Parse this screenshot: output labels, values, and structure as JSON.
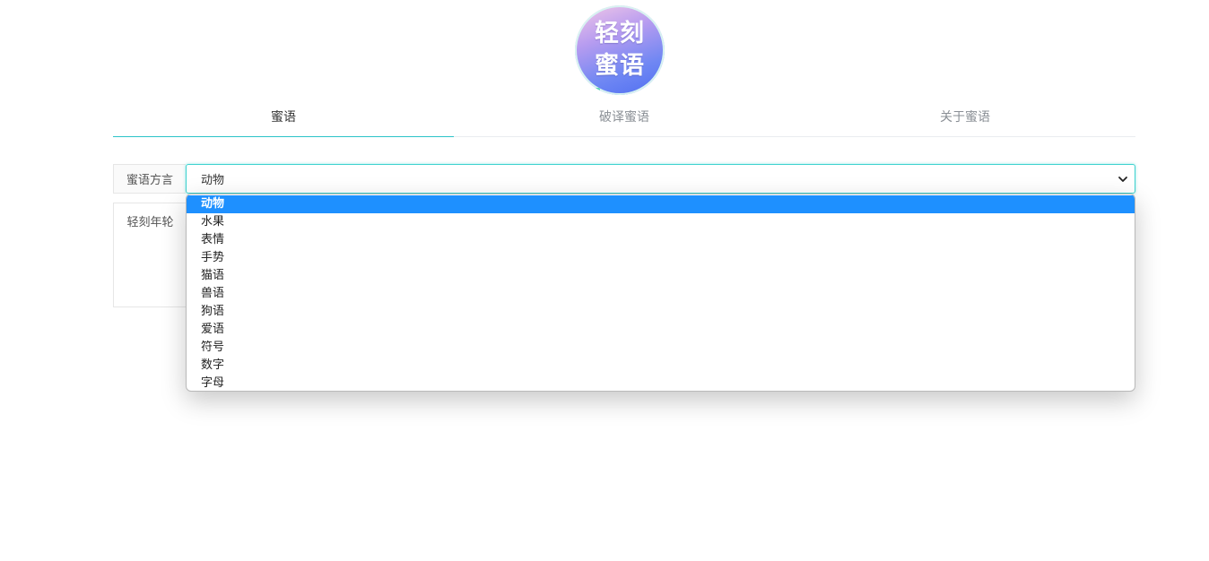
{
  "logo": {
    "line1": "轻刻",
    "line2": "蜜语"
  },
  "tabs": [
    {
      "label": "蜜语",
      "active": true
    },
    {
      "label": "破译蜜语",
      "active": false
    },
    {
      "label": "关于蜜语",
      "active": false
    }
  ],
  "form": {
    "dialect_label": "蜜语方言",
    "dialect_value": "动物",
    "text_label": "轻刻年轮"
  },
  "dropdown": {
    "options": [
      "动物",
      "水果",
      "表情",
      "手势",
      "猫语",
      "兽语",
      "狗语",
      "爱语",
      "符号",
      "数字",
      "字母"
    ],
    "selected_index": 0
  },
  "colors": {
    "accent": "#2cc3c8",
    "select_border": "#3fd2cf",
    "option_highlight": "#1e90ff"
  }
}
